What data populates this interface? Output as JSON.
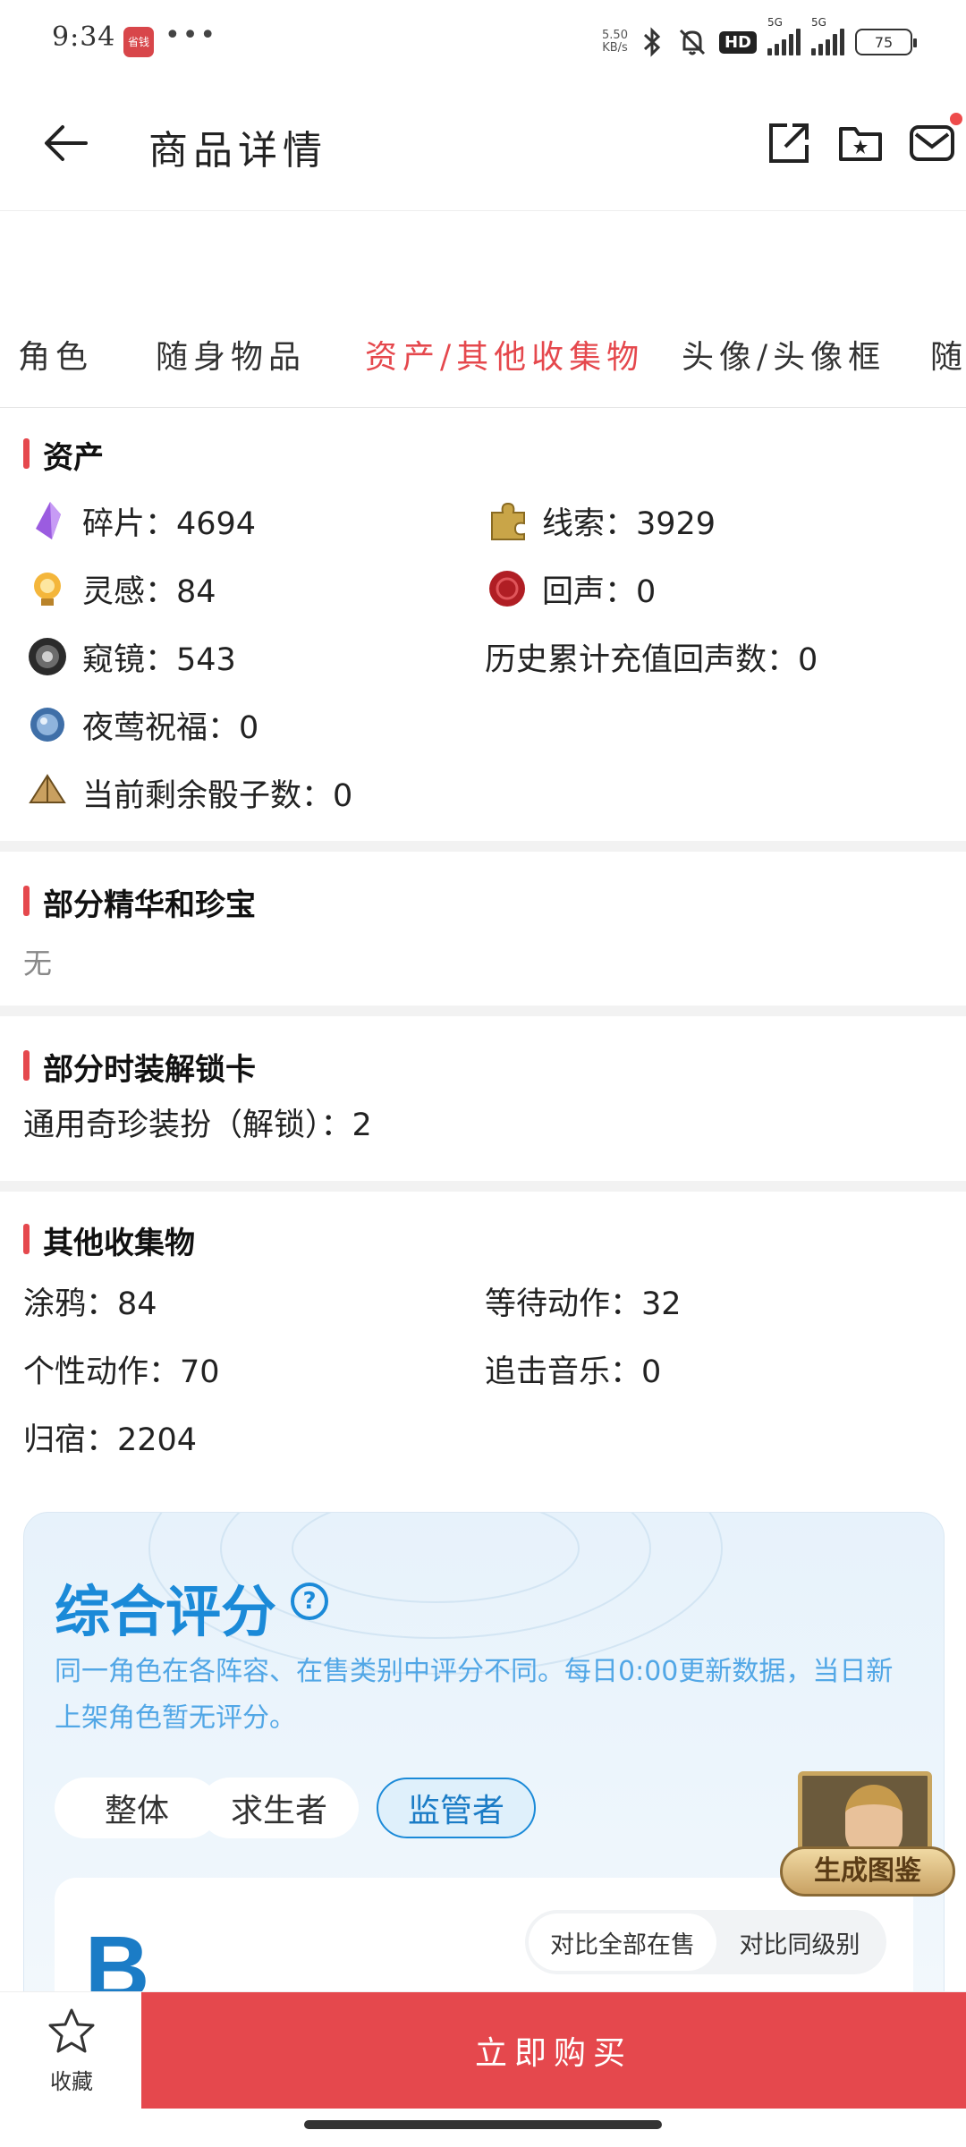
{
  "status_bar": {
    "time": "9:34",
    "app_badge": "省钱",
    "dots": "•••",
    "net_speed_value": "5.50",
    "net_speed_unit": "KB/s",
    "hd_badge": "HD",
    "signal_1_label": "5G",
    "signal_2_label": "5G",
    "battery": "75"
  },
  "header": {
    "title": "商品详情"
  },
  "tabs": [
    {
      "label": "角色"
    },
    {
      "label": "随身物品"
    },
    {
      "label": "资产/其他收集物"
    },
    {
      "label": "头像/头像框"
    },
    {
      "label": "随"
    }
  ],
  "assets": {
    "title": "资产",
    "items": [
      {
        "label": "碎片：4694",
        "icon": "purple-crystal-icon"
      },
      {
        "label": "线索：3929",
        "icon": "puzzle-piece-icon"
      },
      {
        "label": "灵感：84",
        "icon": "lightbulb-icon"
      },
      {
        "label": "回声：0",
        "icon": "red-seal-icon"
      },
      {
        "label": "窥镜：543",
        "icon": "lens-icon"
      },
      {
        "label": "历史累计充值回声数：0",
        "icon": ""
      },
      {
        "label": "夜莺祝福：0",
        "icon": "blue-orb-icon"
      },
      {
        "label": "当前剩余骰子数：0",
        "icon": "dice-icon"
      }
    ]
  },
  "essence": {
    "title": "部分精华和珍宝",
    "value": "无"
  },
  "unlock_cards": {
    "title": "部分时装解锁卡",
    "value": "通用奇珍装扮（解锁）：2"
  },
  "collectibles": {
    "title": "其他收集物",
    "items": [
      {
        "label": "涂鸦：84"
      },
      {
        "label": "等待动作：32"
      },
      {
        "label": "个性动作：70"
      },
      {
        "label": "追击音乐：0"
      },
      {
        "label": "归宿：2204"
      }
    ]
  },
  "score": {
    "title": "综合评分",
    "help": "?",
    "description": "同一角色在各阵容、在售类别中评分不同。每日0:00更新数据，当日新上架角色暂无评分。",
    "filters": [
      {
        "label": "整体"
      },
      {
        "label": "求生者"
      },
      {
        "label": "监管者"
      }
    ],
    "active_filter": "监管者",
    "rank": "B",
    "compare_all": "对比全部在售",
    "compare_same": "对比同级别",
    "generate_label": "生成图鉴"
  },
  "bottom": {
    "favorite_label": "收藏",
    "buy_label": "立即购买"
  },
  "colors": {
    "accent_red": "#e5484d",
    "score_blue": "#1b8ad8"
  }
}
